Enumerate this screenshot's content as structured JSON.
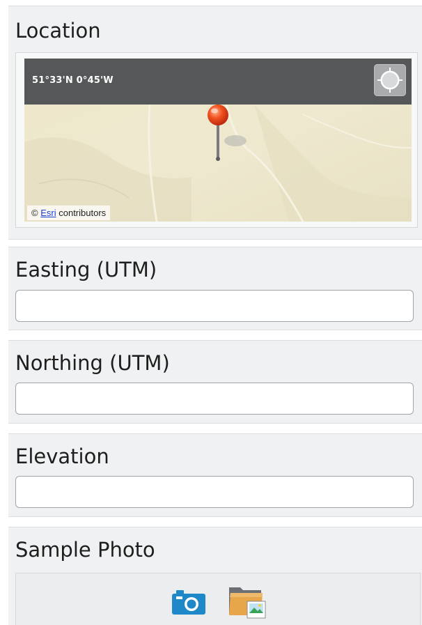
{
  "location": {
    "label": "Location",
    "map": {
      "coordinates": "51°33'N 0°45'W",
      "attribution_prefix": "©",
      "attribution_link": "Esri",
      "attribution_suffix": "contributors",
      "locate_icon": "crosshair-locate-icon",
      "pin_icon": "map-pin-icon"
    }
  },
  "easting": {
    "label": "Easting (UTM)",
    "value": "",
    "placeholder": ""
  },
  "northing": {
    "label": "Northing (UTM)",
    "value": "",
    "placeholder": ""
  },
  "elevation": {
    "label": "Elevation",
    "value": "",
    "placeholder": ""
  },
  "sample_photo": {
    "label": "Sample Photo",
    "camera_icon": "camera-icon",
    "gallery_icon": "image-folder-icon"
  },
  "colors": {
    "section_bg": "#eff1f2",
    "map_header": "#555758",
    "pin_red": "#e2361b",
    "camera_blue": "#1e88c8",
    "folder_orange": "#e8a64a"
  }
}
